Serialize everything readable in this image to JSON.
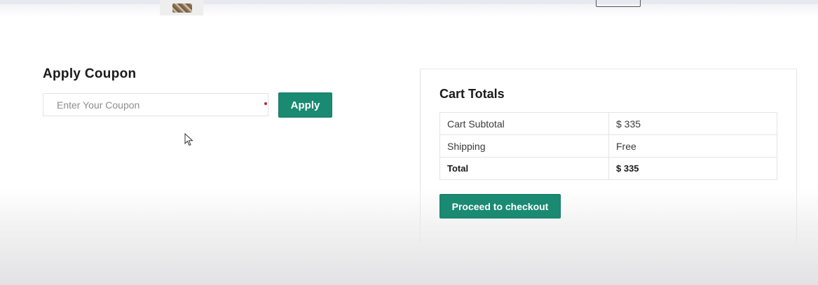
{
  "coupon": {
    "title": "Apply Coupon",
    "input_placeholder": "Enter Your Coupon",
    "input_value": "",
    "apply_label": "Apply"
  },
  "cart_totals": {
    "title": "Cart Totals",
    "rows": [
      {
        "label": "Cart Subtotal",
        "value": "$ 335"
      },
      {
        "label": "Shipping",
        "value": "Free"
      },
      {
        "label": "Total",
        "value": "$ 335"
      }
    ],
    "checkout_label": "Proceed to checkout"
  },
  "colors": {
    "accent": "#1a8a72",
    "required_marker": "#c0242b"
  },
  "icons": {
    "cursor": "mouse-pointer-icon"
  }
}
